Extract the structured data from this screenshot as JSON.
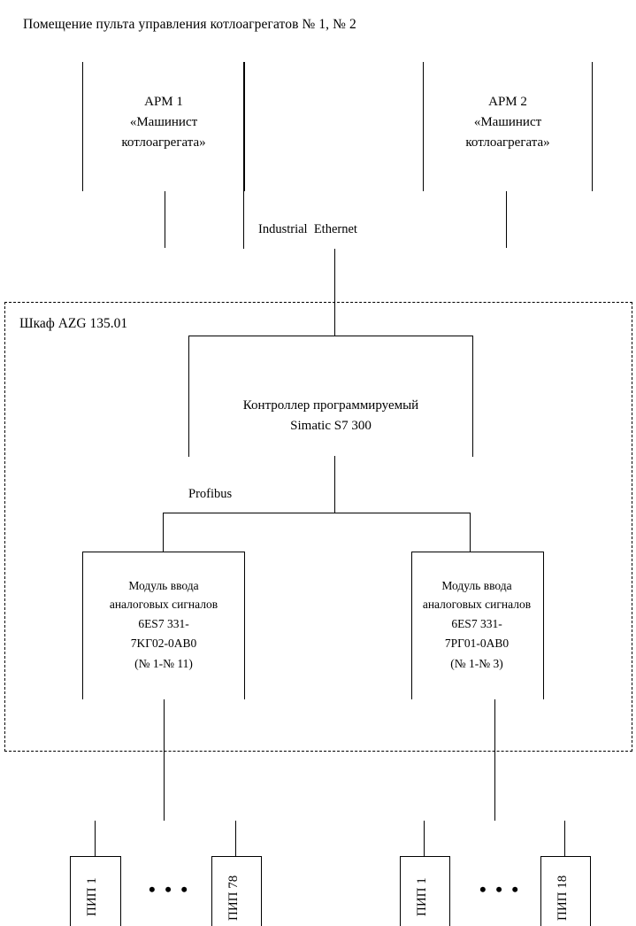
{
  "diagram": {
    "title": "Помещение пульта управления котлоагрегатов № 1, № 2",
    "cabinet_label": "Шкаф AZG 135.01",
    "workstations": [
      {
        "name": "АРМ 1",
        "role_line1": "«Машинист",
        "role_line2": "котлоагрегата»"
      },
      {
        "name": "АРМ 2",
        "role_line1": "«Машинист",
        "role_line2": "котлоагрегата»"
      }
    ],
    "networks": {
      "ethernet": "Industrial  Ethernet",
      "fieldbus": "Profibus"
    },
    "controller": {
      "line1": "Контроллер программируемый",
      "line2": "Simatic S7 300"
    },
    "io_modules": [
      {
        "line1": "Модуль ввода",
        "line2": "аналоговых сигналов",
        "line3": "6ES7 331-",
        "line4": "7KГ02-0AB0",
        "line5": "(№ 1-№ 11)"
      },
      {
        "line1": "Модуль ввода",
        "line2": "аналоговых сигналов",
        "line3": "6ES7 331-",
        "line4": "7PГ01-0AB0",
        "line5": "(№ 1-№ 3)"
      }
    ],
    "sensors": [
      {
        "label": "ПИП 1"
      },
      {
        "label": "ПИП 78"
      },
      {
        "label": "ПИП 1"
      },
      {
        "label": "ПИП 18"
      }
    ],
    "ellipsis": "• • •",
    "colors": {
      "line": "#000000",
      "background": "#ffffff",
      "text": "#000000"
    }
  }
}
